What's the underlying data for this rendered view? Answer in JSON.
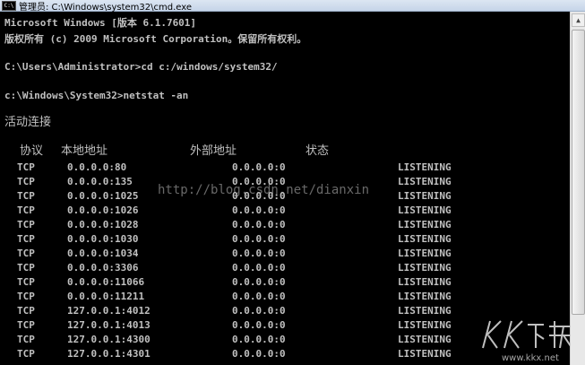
{
  "window": {
    "title": "管理员: C:\\Windows\\system32\\cmd.exe",
    "icon": "cmd-icon",
    "icon_text": "C:\\"
  },
  "console": {
    "banner_line1": "Microsoft Windows [版本 6.1.7601]",
    "banner_line2": "版权所有 (c) 2009 Microsoft Corporation。保留所有权利。",
    "cmd1_prompt": "C:\\Users\\Administrator>",
    "cmd1_text": "cd c:/windows/system32/",
    "cmd2_prompt": "c:\\Windows\\System32>",
    "cmd2_text": "netstat -an",
    "section_title": "活动连接",
    "headers": [
      "协议",
      "本地地址",
      "外部地址",
      "状态"
    ],
    "rows": [
      [
        "TCP",
        "0.0.0.0:80",
        "0.0.0.0:0",
        "LISTENING"
      ],
      [
        "TCP",
        "0.0.0.0:135",
        "0.0.0.0:0",
        "LISTENING"
      ],
      [
        "TCP",
        "0.0.0.0:1025",
        "0.0.0.0:0",
        "LISTENING"
      ],
      [
        "TCP",
        "0.0.0.0:1026",
        "0.0.0.0:0",
        "LISTENING"
      ],
      [
        "TCP",
        "0.0.0.0:1028",
        "0.0.0.0:0",
        "LISTENING"
      ],
      [
        "TCP",
        "0.0.0.0:1030",
        "0.0.0.0:0",
        "LISTENING"
      ],
      [
        "TCP",
        "0.0.0.0:1034",
        "0.0.0.0:0",
        "LISTENING"
      ],
      [
        "TCP",
        "0.0.0.0:3306",
        "0.0.0.0:0",
        "LISTENING"
      ],
      [
        "TCP",
        "0.0.0.0:11066",
        "0.0.0.0:0",
        "LISTENING"
      ],
      [
        "TCP",
        "0.0.0.0:11211",
        "0.0.0.0:0",
        "LISTENING"
      ],
      [
        "TCP",
        "127.0.0.1:4012",
        "0.0.0.0:0",
        "LISTENING"
      ],
      [
        "TCP",
        "127.0.0.1:4013",
        "0.0.0.0:0",
        "LISTENING"
      ],
      [
        "TCP",
        "127.0.0.1:4300",
        "0.0.0.0:0",
        "LISTENING"
      ],
      [
        "TCP",
        "127.0.0.1:4301",
        "0.0.0.0:0",
        "LISTENING"
      ]
    ]
  },
  "watermark": {
    "text": "http://blog.csdn.net/dianxin",
    "logo_text": "KK下载",
    "site": "www.kkx.net"
  },
  "colors": {
    "console_bg": "#000000",
    "console_fg": "#c0c0c0",
    "titlebar": "#dce6f2"
  }
}
